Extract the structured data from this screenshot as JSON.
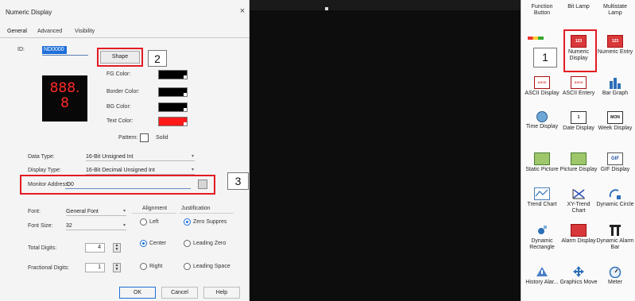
{
  "dialog": {
    "title": "Numeric Display",
    "close_glyph": "×",
    "tabs": [
      "General",
      "Advanced",
      "Visibility"
    ],
    "id_label": "ID:",
    "id_value": "ND0000",
    "shape_button": "Shape",
    "preview_text": "888.\n8",
    "fg_color_label": "FG Color:",
    "border_color_label": "Border Color:",
    "bg_color_label": "BG Color:",
    "text_color_label": "Text Color:",
    "pattern_label": "Pattern:",
    "pattern_value": "Solid",
    "data_type_label": "Data Type:",
    "data_type_value": "16-Bit Unsigned Int",
    "display_type_label": "Display Type:",
    "display_type_value": "16-Bit Decimal Unsigned Int",
    "monitor_address_label": "Monitor Address:",
    "monitor_address_value": "D0",
    "font_label": "Font:",
    "font_value": "General Font",
    "font_size_label": "Font Size:",
    "font_size_value": "32",
    "total_digits_label": "Total Digits:",
    "total_digits_value": "4",
    "fractional_digits_label": "Fractional Digits:",
    "fractional_digits_value": "1",
    "alignment_label": "Alignment",
    "alignment_options": [
      "Left",
      "Center",
      "Right"
    ],
    "alignment_selected": "Center",
    "justification_label": "Justification",
    "justification_options": [
      "Zero Suppres",
      "Leading Zero",
      "Leading Space"
    ],
    "justification_selected": "Zero Suppres",
    "ok_button": "OK",
    "cancel_button": "Cancel",
    "help_button": "Help",
    "colors": {
      "fg": "#000000",
      "border": "#000000",
      "bg": "#000000",
      "text": "#ff1a1a",
      "preview_text": "#ff2a2a",
      "highlight": "#e31b23"
    }
  },
  "callouts": [
    "1",
    "2",
    "3"
  ],
  "palette": {
    "items": [
      {
        "label": "Function Button",
        "icon": "function-button-icon"
      },
      {
        "label": "Bit Lamp",
        "icon": "bit-lamp-icon"
      },
      {
        "label": "Multistate Lamp",
        "icon": "multistate-lamp-icon"
      },
      {
        "label": "Numeric Display",
        "icon": "numeric-display-icon",
        "icon_text": "123"
      },
      {
        "label": "Numeric Entry",
        "icon": "numeric-entry-icon",
        "icon_text": "123"
      },
      {
        "label": "ASCII Display",
        "icon": "ascii-display-icon",
        "icon_text": "ASCII"
      },
      {
        "label": "ASCII Entery",
        "icon": "ascii-entry-icon",
        "icon_text": "ASCII"
      },
      {
        "label": "Bar Graph",
        "icon": "bar-graph-icon"
      },
      {
        "label": "Time Display",
        "icon": "time-display-icon"
      },
      {
        "label": "Date Display",
        "icon": "date-display-icon",
        "icon_text": "1"
      },
      {
        "label": "Week Display",
        "icon": "week-display-icon",
        "icon_text": "MON"
      },
      {
        "label": "Static Picture",
        "icon": "static-picture-icon"
      },
      {
        "label": "Picture Display",
        "icon": "picture-display-icon"
      },
      {
        "label": "GIF Display",
        "icon": "gif-display-icon",
        "icon_text": "GIF"
      },
      {
        "label": "Trend Chart",
        "icon": "trend-chart-icon"
      },
      {
        "label": "XY-Trend Chart",
        "icon": "xy-trend-chart-icon"
      },
      {
        "label": "Dynamic Circle",
        "icon": "dynamic-circle-icon"
      },
      {
        "label": "Dynamic Rectangle",
        "icon": "dynamic-rectangle-icon"
      },
      {
        "label": "Alarm Display",
        "icon": "alarm-display-icon"
      },
      {
        "label": "Dynamic Alarm Bar",
        "icon": "dynamic-alarm-bar-icon"
      },
      {
        "label": "History Alar...",
        "icon": "history-alarm-icon"
      },
      {
        "label": "Graphics Move",
        "icon": "graphics-move-icon"
      },
      {
        "label": "Meter",
        "icon": "meter-icon"
      }
    ]
  }
}
